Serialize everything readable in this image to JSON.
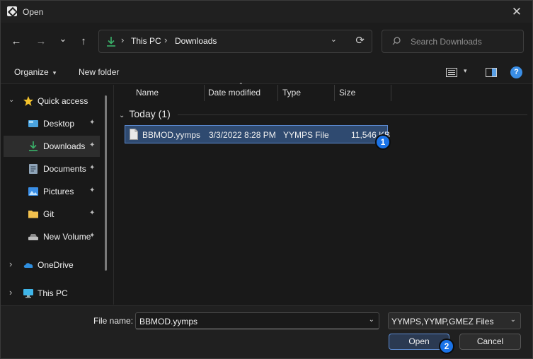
{
  "window": {
    "title": "Open",
    "close_glyph": "✕"
  },
  "nav": {
    "back": "←",
    "forward": "→",
    "recent": "⌄",
    "up": "↑"
  },
  "address": {
    "icon": "download-icon",
    "crumbs": [
      "This PC",
      "Downloads"
    ],
    "separator": "›",
    "dropdown_glyph": "⌄",
    "refresh_glyph": "⟳"
  },
  "search": {
    "placeholder": "Search Downloads",
    "icon": "search-icon"
  },
  "commandbar": {
    "organize": "Organize",
    "organize_arrow": "▾",
    "new_folder": "New folder",
    "view_arrow": "▾",
    "help": "?"
  },
  "sidebar": {
    "items": [
      {
        "label": "Quick access",
        "icon": "star-icon",
        "expander": "⌄",
        "pinned": false
      },
      {
        "label": "Desktop",
        "icon": "desktop-icon",
        "pinned": true
      },
      {
        "label": "Downloads",
        "icon": "download-icon",
        "pinned": true,
        "selected": true
      },
      {
        "label": "Documents",
        "icon": "document-icon",
        "pinned": true
      },
      {
        "label": "Pictures",
        "icon": "pictures-icon",
        "pinned": true
      },
      {
        "label": "Git",
        "icon": "folder-icon",
        "pinned": true
      },
      {
        "label": "New Volume",
        "icon": "drive-icon",
        "pinned": true
      },
      {
        "label": "OneDrive",
        "icon": "cloud-icon",
        "expander": "›"
      },
      {
        "label": "This PC",
        "icon": "computer-icon",
        "expander": "›"
      }
    ],
    "pin_glyph": "📌"
  },
  "columns": [
    "Name",
    "Date modified",
    "Type",
    "Size"
  ],
  "sort_glyph": "⌃",
  "group": {
    "label": "Today (1)",
    "chevron": "⌄"
  },
  "files": [
    {
      "name": "BBMOD.yymps",
      "date": "3/3/2022 8:28 PM",
      "type": "YYMPS File",
      "size": "11,546 KB",
      "icon": "file-icon"
    }
  ],
  "bottom": {
    "filename_label": "File name:",
    "filename_value": "BBMOD.yymps",
    "filetype_value": "YYMPS,YYMP,GMEZ Files",
    "dropdown_glyph": "⌄",
    "open_label": "Open",
    "cancel_label": "Cancel"
  },
  "badges": [
    "1",
    "2"
  ],
  "colors": {
    "accent": "#1a73e8",
    "selection": "#2f4a70",
    "download_green": "#3ab26a"
  }
}
